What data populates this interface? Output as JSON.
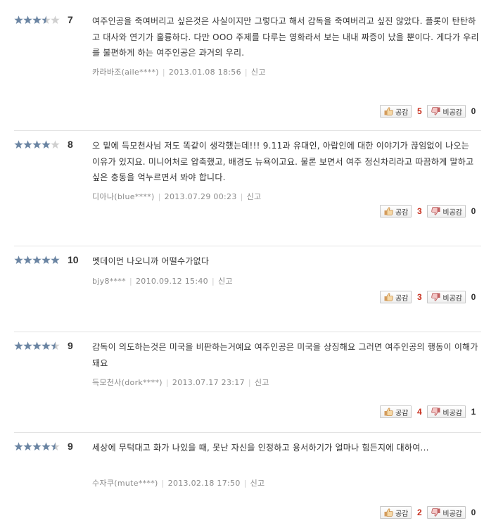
{
  "colors": {
    "star_on": "#6b85a3",
    "star_off": "#d0d0d0",
    "like_count": "#c8301f",
    "meta": "#8a8a8a",
    "divider": "#e3e3e3"
  },
  "icons": {
    "like": "thumbs-up-icon",
    "dislike": "thumbs-down-icon",
    "star": "star-icon"
  },
  "labels": {
    "like": "공감",
    "dislike": "비공감",
    "report": "신고"
  },
  "reviews": [
    {
      "rating": 3.5,
      "score": "7",
      "text": "여주인공을 죽여버리고 싶은것은 사실이지만 그렇다고 해서 감독을 죽여버리고 싶진 않았다. 플롯이 탄탄하고 대사와 연기가 훌륭하다. 다만 OOO 주제를 다루는 영화라서 보는 내내 짜증이 났을 뿐이다. 게다가 우리를 불편하게 하는 여주인공은 과거의 우리.",
      "author": "카라바조(aile****)",
      "date": "2013.01.08 18:56",
      "likes": "5",
      "dislikes": "0"
    },
    {
      "rating": 4,
      "score": "8",
      "text": "오 밑에 득모천사님 저도 똑같이 생각했는데!!! 9.11과 유대인, 아랍인에 대한 이야기가 끊임없이 나오는 이유가 있지요. 미니어처로 압축했고, 배경도 뉴욕이고요. 물론 보면서 여주 정신차리라고 따끔하게 말하고 싶은 충동을 억누르면서 봐야 합니다.",
      "author": "디아나(blue****)",
      "date": "2013.07.29 00:23",
      "likes": "3",
      "dislikes": "0"
    },
    {
      "rating": 5,
      "score": "10",
      "text": "멧데이먼 나오니까 어떨수가없다",
      "author": "bjy8****",
      "date": "2010.09.12 15:40",
      "likes": "3",
      "dislikes": "0"
    },
    {
      "rating": 4.5,
      "score": "9",
      "text": "감독이 의도하는것은 미국을 비판하는거예요 여주인공은 미국을 상징해요 그러면 여주인공의 행동이 이해가 돼요",
      "author": "득모천사(dork****)",
      "date": "2013.07.17 23:17",
      "likes": "4",
      "dislikes": "1"
    },
    {
      "rating": 4.5,
      "score": "9",
      "text": "세상에 무턱대고 화가 나있을 때, 못난 자신을 인정하고 용서하기가 얼마나 힘든지에 대하여...",
      "author": "수자쿠(mute****)",
      "date": "2013.02.18 17:50",
      "likes": "2",
      "dislikes": "0"
    }
  ]
}
